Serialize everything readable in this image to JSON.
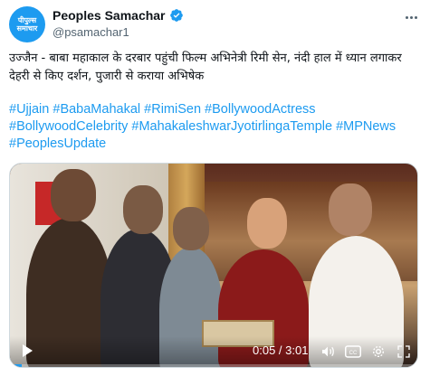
{
  "account": {
    "avatar_text": "पीपुल्स समाचार",
    "display_name": "Peoples Samachar",
    "handle": "@psamachar1"
  },
  "tweet": {
    "text": "उज्जैन - बाबा महाकाल के दरबार पहुंची फिल्म अभिनेत्री रिमी सेन, नंदी हाल में ध्यान लगाकर देहरी से किए दर्शन, पुजारी से कराया अभिषेक",
    "hashtags": [
      "#Ujjain",
      "#BabaMahakal",
      "#RimiSen",
      "#BollywoodActress",
      "#BollywoodCelebrity",
      "#MahakaleshwarJyotirlingaTemple",
      "#MPNews",
      "#PeoplesUpdate"
    ]
  },
  "video": {
    "time": "0:05 / 3:01",
    "progress": 0.028
  },
  "icons": {
    "verified": "verified-badge-icon",
    "more": "more-options-icon",
    "play": "play-icon",
    "volume": "volume-icon",
    "captions": "captions-icon",
    "settings": "settings-icon",
    "fullscreen": "fullscreen-icon"
  },
  "colors": {
    "accent": "#1d9bf0",
    "text": "#0f1419",
    "muted": "#536471"
  }
}
